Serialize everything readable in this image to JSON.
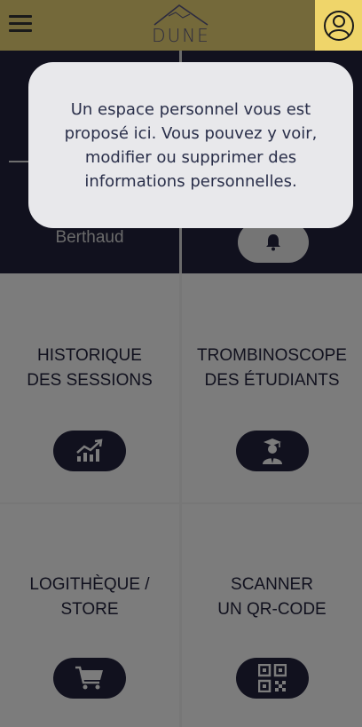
{
  "header": {
    "logo_text": "DUNE",
    "menu_icon": "hamburger-menu-icon",
    "profile_icon": "user-profile-icon"
  },
  "tiles": {
    "profile": {
      "name": "Berthaud"
    },
    "notifications": {
      "icon": "bell-icon"
    },
    "sessions": {
      "label": "HISTORIQUE\nDES SESSIONS",
      "icon": "chart-growth-icon"
    },
    "students": {
      "label": "TROMBINOSCOPE\nDES ÉTUDIANTS",
      "icon": "graduate-icon"
    },
    "store": {
      "label": "LOGITHÈQUE /\nSTORE",
      "icon": "cart-icon"
    },
    "scanner": {
      "label": "SCANNER\nUN QR-CODE",
      "icon": "qr-code-icon"
    }
  },
  "tooltip": {
    "text": "Un espace personnel vous est proposé ici. Vous pouvez y voir, modifier ou supprimer des informations personnelles."
  },
  "colors": {
    "header_bg": "#74693a",
    "profile_button_bg": "#efd56a",
    "tile_dark": "#11111e",
    "tile_grey": "#7c7c7c",
    "dialog_bg": "#e8e8eb"
  }
}
